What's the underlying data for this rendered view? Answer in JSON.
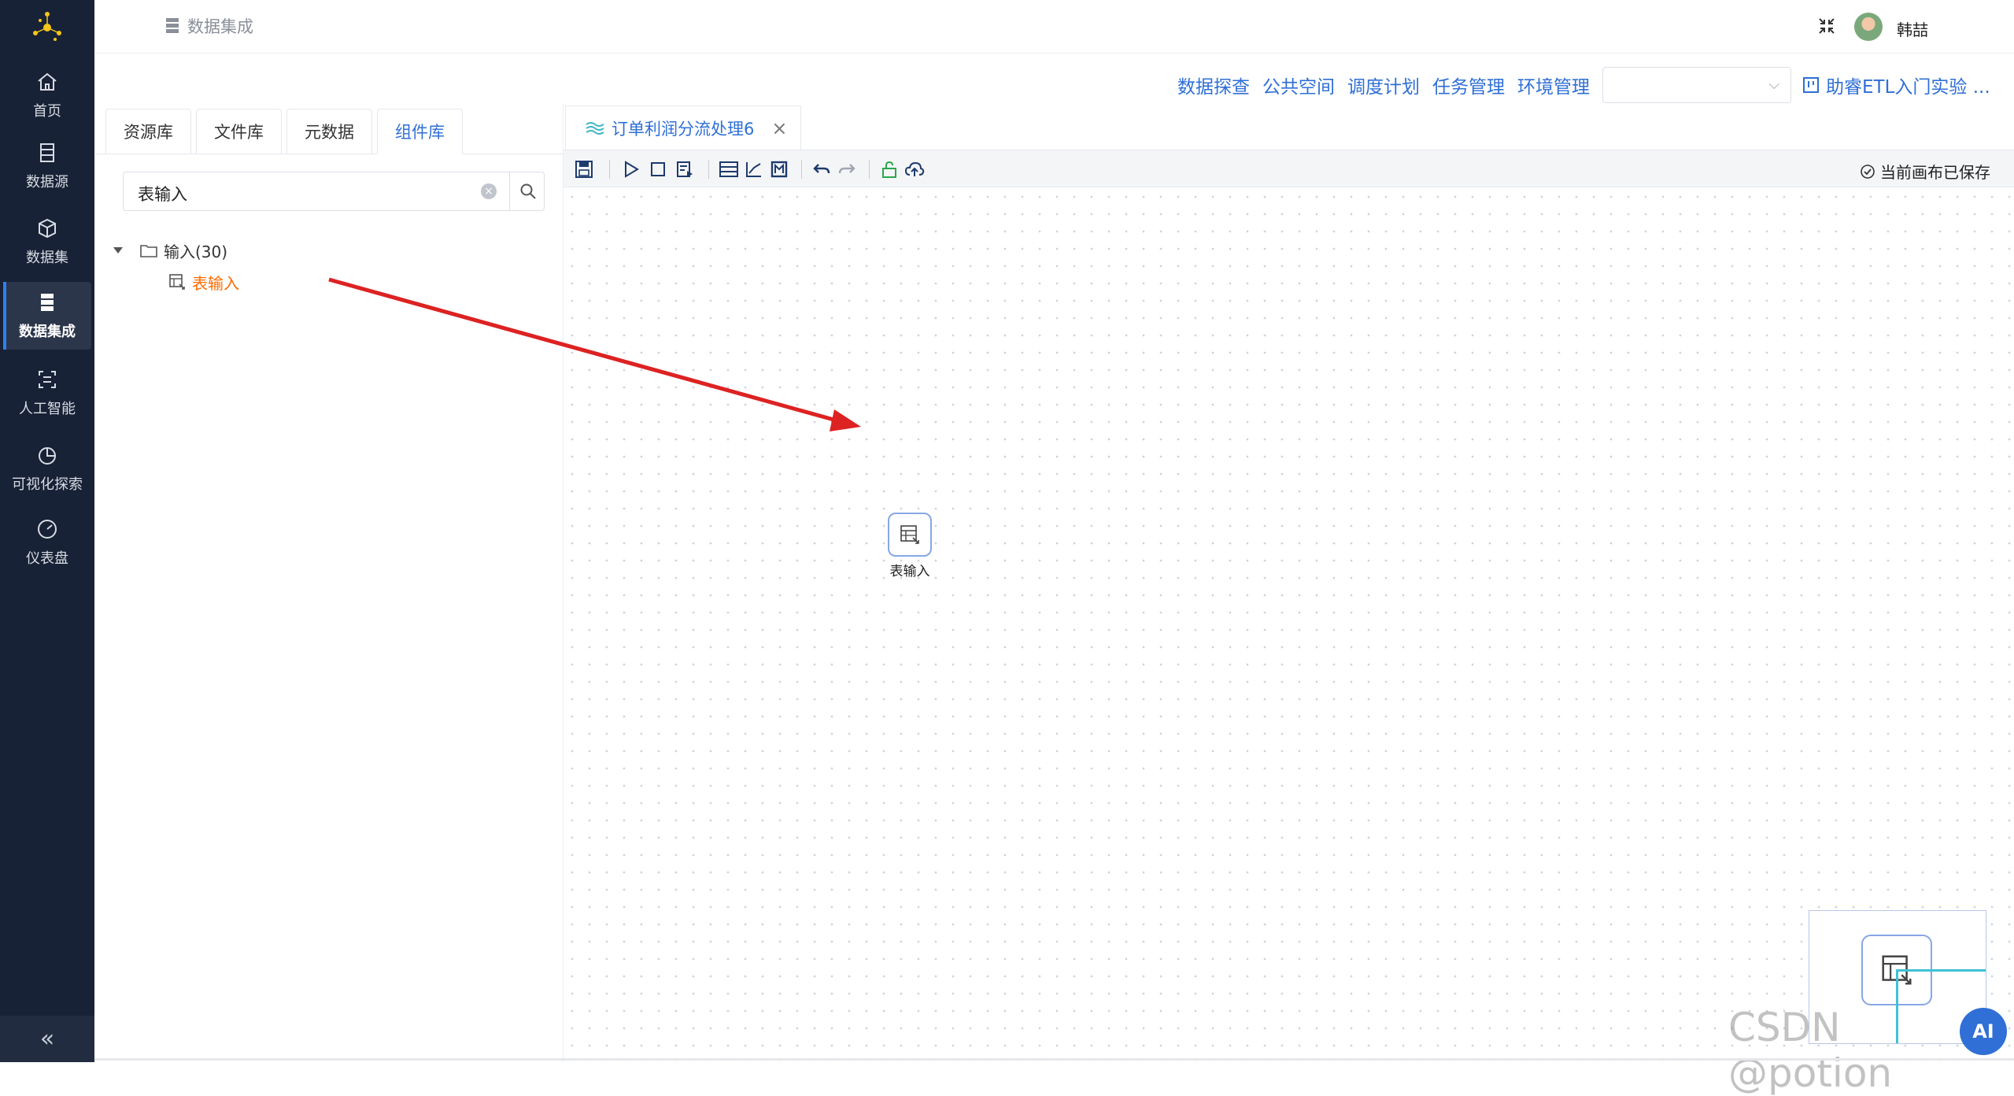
{
  "nav": {
    "items": [
      {
        "label": "首页",
        "icon": "home-icon"
      },
      {
        "label": "数据源",
        "icon": "database-icon"
      },
      {
        "label": "数据集",
        "icon": "cube-icon"
      },
      {
        "label": "数据集成",
        "icon": "server-icon",
        "active": true
      },
      {
        "label": "人工智能",
        "icon": "scan-icon"
      },
      {
        "label": "可视化探索",
        "icon": "pie-icon"
      },
      {
        "label": "仪表盘",
        "icon": "gauge-icon"
      }
    ],
    "collapse": "«"
  },
  "header": {
    "breadcrumb": "数据集成",
    "user": "韩喆"
  },
  "topmenu": {
    "links": [
      "数据探查",
      "公共空间",
      "调度计划",
      "任务管理",
      "环境管理"
    ],
    "select_value": "",
    "project": "助睿ETL入门实验 ..."
  },
  "left_panel": {
    "tabs": [
      "资源库",
      "文件库",
      "元数据",
      "组件库"
    ],
    "active_tab": "组件库",
    "search_value": "表输入",
    "tree": {
      "folder": "输入(30)",
      "item": "表输入"
    }
  },
  "editor": {
    "tab_title": "订单利润分流处理6",
    "saved_status": "当前画布已保存",
    "node_label": "表输入"
  },
  "colors": {
    "nav_bg": "#182236",
    "accent": "#2f6fd6",
    "highlight": "#ff6a00",
    "arrow": "#dd2222"
  },
  "overlay": {
    "ai_badge": "AI",
    "watermark": "CSDN @potion"
  }
}
